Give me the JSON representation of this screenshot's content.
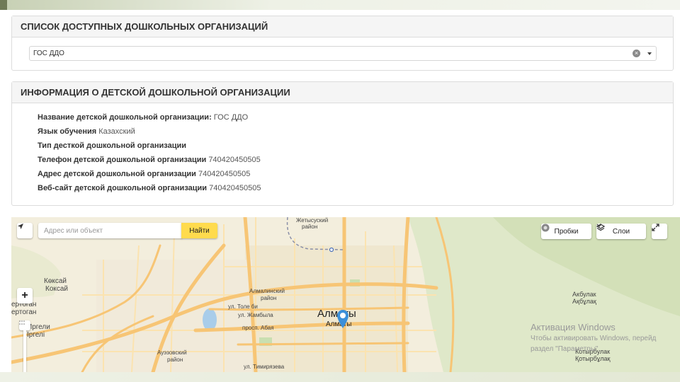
{
  "list_panel": {
    "title": "СПИСОК ДОСТУПНЫХ ДОШКОЛЬНЫХ ОРГАНИЗАЦИЙ",
    "selected_value": "ГОС ДДО",
    "clear_glyph": "×"
  },
  "info_panel": {
    "title": "ИНФОРМАЦИЯ О ДЕТСКОЙ ДОШКОЛЬНОЙ ОРГАНИЗАЦИИ",
    "rows": [
      {
        "label": "Название детской дошкольной организации:",
        "value": "ГОС ДДО"
      },
      {
        "label": "Язык обучения",
        "value": "Казахский"
      },
      {
        "label": "Тип десткой дошкольной организации",
        "value": ""
      },
      {
        "label": "Телефон детской дошкольной организации",
        "value": "740420450505"
      },
      {
        "label": "Адрес детской дошкольной организации",
        "value": "740420450505"
      },
      {
        "label": "Веб-сайт детской дошкольной организации",
        "value": "740420450505"
      }
    ]
  },
  "map": {
    "search_placeholder": "Адрес или объект",
    "find_label": "Найти",
    "traffic_label": "Пробки",
    "layers_label": "Слои",
    "zoom_in_glyph": "+",
    "labels": {
      "city": "Алматы",
      "city_sub": "Алматы",
      "koksai": "Көксай",
      "koksai2": "Коксай",
      "ertogan": "ертоган",
      "ertogan2": "ертоган",
      "irgeli": "Иргели",
      "irgeli2": "Іргелі",
      "zhetysu": "Жетысуский",
      "zhetysu_rayon": "район",
      "almaly": "Алмалинский",
      "almaly_rayon": "район",
      "auezov": "Ауэзовский",
      "auezov_rayon": "район",
      "tole_bi": "ул. Толе би",
      "zhambyla": "ул. Жамбыла",
      "abaya": "просп. Абая",
      "timiryazeva": "ул. Тимирязева",
      "akbulak": "Акбулак",
      "akbulak2": "Ақбұлақ",
      "kotyrbulak": "Котырбулак",
      "kotyrbulak2": "Қотырбұлақ"
    },
    "watermark_title": "Активация Windows",
    "watermark_line1": "Чтобы активировать Windows, перейд",
    "watermark_line2": "раздел \"Параметры\"."
  },
  "colors": {
    "panel_header_bg": "#f5f5f5",
    "map_bg": "#f3eedd",
    "road_major": "#f7c575",
    "find_button": "#ffdb4d",
    "pin": "#3b8fd9"
  }
}
